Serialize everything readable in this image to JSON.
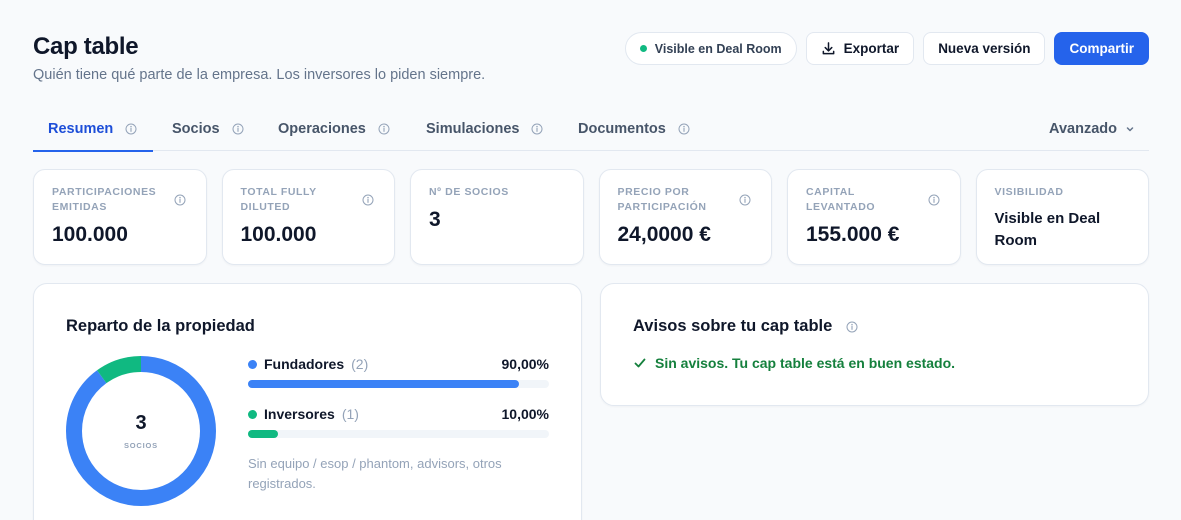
{
  "header": {
    "title": "Cap table",
    "subtitle": "Quién tiene qué parte de la empresa. Los inversores lo piden siempre.",
    "visibility_pill": "Visible en Deal Room",
    "export_label": "Exportar",
    "new_version_label": "Nueva versión",
    "share_label": "Compartir"
  },
  "tabs": [
    {
      "label": "Resumen",
      "active": true
    },
    {
      "label": "Socios"
    },
    {
      "label": "Operaciones"
    },
    {
      "label": "Simulaciones"
    },
    {
      "label": "Documentos"
    }
  ],
  "advanced_label": "Avanzado",
  "stats": [
    {
      "label": "PARTICIPACIONES EMITIDAS",
      "value": "100.000"
    },
    {
      "label": "TOTAL FULLY DILUTED",
      "value": "100.000"
    },
    {
      "label": "Nº DE SOCIOS",
      "value": "3"
    },
    {
      "label": "PRECIO POR PARTICIPACIÓN",
      "value": "24,0000 €"
    },
    {
      "label": "CAPITAL LEVANTADO",
      "value": "155.000 €"
    },
    {
      "label": "VISIBILIDAD",
      "value": "Visible en Deal Room"
    }
  ],
  "ownership": {
    "title": "Reparto de la propiedad",
    "total": "3",
    "total_label": "SOCIOS",
    "groups": [
      {
        "name": "Fundadores",
        "count": "(2)",
        "percent_label": "90,00%",
        "share": 0.9,
        "color": "#3b82f6"
      },
      {
        "name": "Inversores",
        "count": "(1)",
        "percent_label": "10,00%",
        "share": 0.1,
        "color": "#10b981"
      }
    ],
    "note": "Sin equipo / esop / phantom, advisors, otros registrados."
  },
  "alerts": {
    "title": "Avisos sobre tu cap table",
    "status": "Sin avisos. Tu cap table está en buen estado."
  },
  "colors": {
    "accent": "#2563eb",
    "founders": "#3b82f6",
    "investors": "#10b981",
    "ok": "#15803d"
  }
}
